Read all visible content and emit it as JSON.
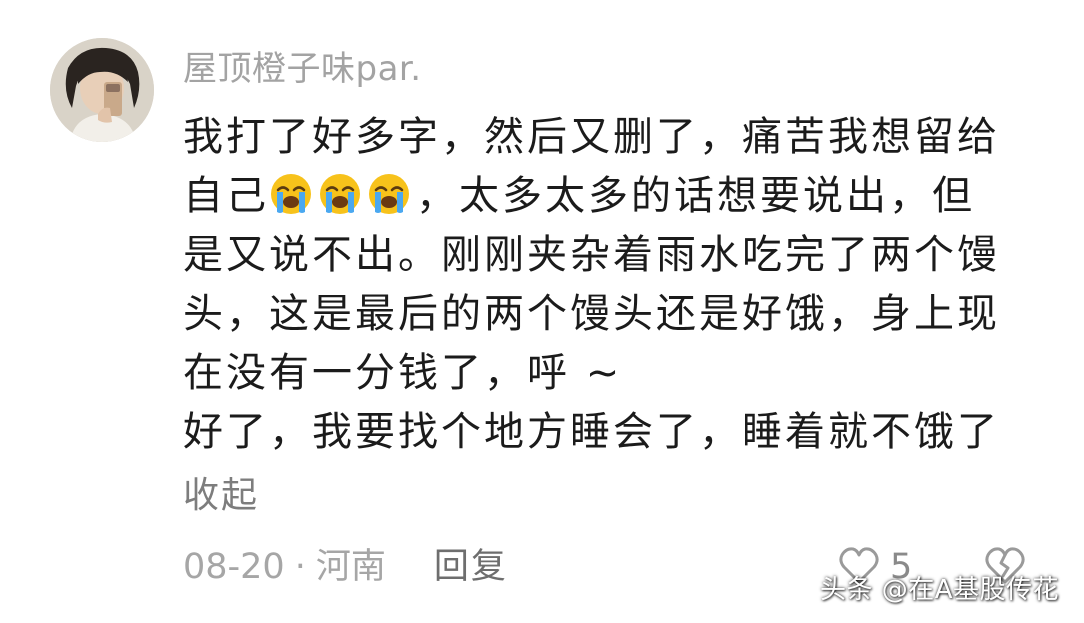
{
  "comment": {
    "username": "屋顶橙子味par.",
    "lines": [
      "我打了好多字，然后又删了，痛苦我想留给",
      "，太多太多的话想要说出，但",
      "是又说不出。刚刚夹杂着雨水吃完了两个馒",
      "头，这是最后的两个馒头还是好饿，身上现",
      "在没有一分钱了，呼 ~",
      "好了，我要找个地方睡会了，睡着就不饿了"
    ],
    "line2_prefix": "自己",
    "emoji_name": "loudly-crying-face",
    "collapse_label": "收起",
    "date": "08-20",
    "separator": "·",
    "location": "河南",
    "reply_label": "回复",
    "like_count": "5",
    "colors": {
      "username": "#a3a3a3",
      "meta": "#a6a6a6",
      "reply": "#6e6e6e",
      "emoji": "#f7c21b",
      "tears": "#4aa8f0"
    }
  },
  "watermark": "头条 @在A基股传花"
}
